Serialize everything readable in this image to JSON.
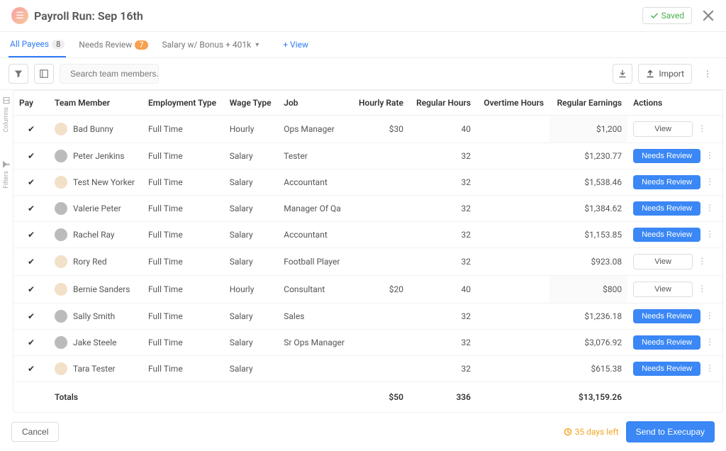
{
  "header": {
    "title": "Payroll Run: Sep 16th",
    "saved_label": "Saved"
  },
  "tabs": {
    "all_payees": "All Payees",
    "all_payees_badge": "8",
    "needs_review": "Needs Review",
    "needs_review_badge": "7",
    "salary_view": "Salary w/ Bonus + 401k",
    "add_view": "+ View"
  },
  "toolbar": {
    "search_placeholder": "Search team members.",
    "import_label": "Import"
  },
  "siderails": {
    "columns": "Columns",
    "filters": "Filters"
  },
  "columns": {
    "pay": "Pay",
    "team_member": "Team Member",
    "employment_type": "Employment Type",
    "wage_type": "Wage Type",
    "job": "Job",
    "hourly_rate": "Hourly Rate",
    "regular_hours": "Regular Hours",
    "overtime_hours": "Overtime Hours",
    "regular_earnings": "Regular Earnings",
    "actions": "Actions"
  },
  "rows": [
    {
      "name": "Bad Bunny",
      "emp": "Full Time",
      "wage": "Hourly",
      "job": "Ops Manager",
      "rate": "$30",
      "hours": "40",
      "ot": "",
      "earn": "$1,200",
      "action": "View",
      "hl": false,
      "sh": true
    },
    {
      "name": "Peter Jenkins",
      "emp": "Full Time",
      "wage": "Salary",
      "job": "Tester",
      "rate": "",
      "hours": "32",
      "ot": "",
      "earn": "$1,230.77",
      "action": "Needs Review",
      "hl": true,
      "sh": false
    },
    {
      "name": "Test New Yorker",
      "emp": "Full Time",
      "wage": "Salary",
      "job": "Accountant",
      "rate": "",
      "hours": "32",
      "ot": "",
      "earn": "$1,538.46",
      "action": "Needs Review",
      "hl": false,
      "sh": false
    },
    {
      "name": "Valerie Peter",
      "emp": "Full Time",
      "wage": "Salary",
      "job": "Manager Of Qa",
      "rate": "",
      "hours": "32",
      "ot": "",
      "earn": "$1,384.62",
      "action": "Needs Review",
      "hl": true,
      "sh": false
    },
    {
      "name": "Rachel Ray",
      "emp": "Full Time",
      "wage": "Salary",
      "job": "Accountant",
      "rate": "",
      "hours": "32",
      "ot": "",
      "earn": "$1,153.85",
      "action": "Needs Review",
      "hl": true,
      "sh": false
    },
    {
      "name": "Rory Red",
      "emp": "Full Time",
      "wage": "Salary",
      "job": "Football Player",
      "rate": "",
      "hours": "32",
      "ot": "",
      "earn": "$923.08",
      "action": "View",
      "hl": false,
      "sh": false
    },
    {
      "name": "Bernie Sanders",
      "emp": "Full Time",
      "wage": "Hourly",
      "job": "Consultant",
      "rate": "$20",
      "hours": "40",
      "ot": "",
      "earn": "$800",
      "action": "View",
      "hl": false,
      "sh": true
    },
    {
      "name": "Sally Smith",
      "emp": "Full Time",
      "wage": "Salary",
      "job": "Sales",
      "rate": "",
      "hours": "32",
      "ot": "",
      "earn": "$1,236.18",
      "action": "Needs Review",
      "hl": true,
      "sh": false
    },
    {
      "name": "Jake Steele",
      "emp": "Full Time",
      "wage": "Salary",
      "job": "Sr Ops Manager",
      "rate": "",
      "hours": "32",
      "ot": "",
      "earn": "$3,076.92",
      "action": "Needs Review",
      "hl": true,
      "sh": false
    },
    {
      "name": "Tara Tester",
      "emp": "Full Time",
      "wage": "Salary",
      "job": "",
      "rate": "",
      "hours": "32",
      "ot": "",
      "earn": "$615.38",
      "action": "Needs Review",
      "hl": false,
      "sh": false
    }
  ],
  "totals": {
    "label": "Totals",
    "rate": "$50",
    "hours": "336",
    "earn": "$13,159.26"
  },
  "footer": {
    "cancel": "Cancel",
    "days_left": "35 days left",
    "send": "Send to Execupay"
  }
}
